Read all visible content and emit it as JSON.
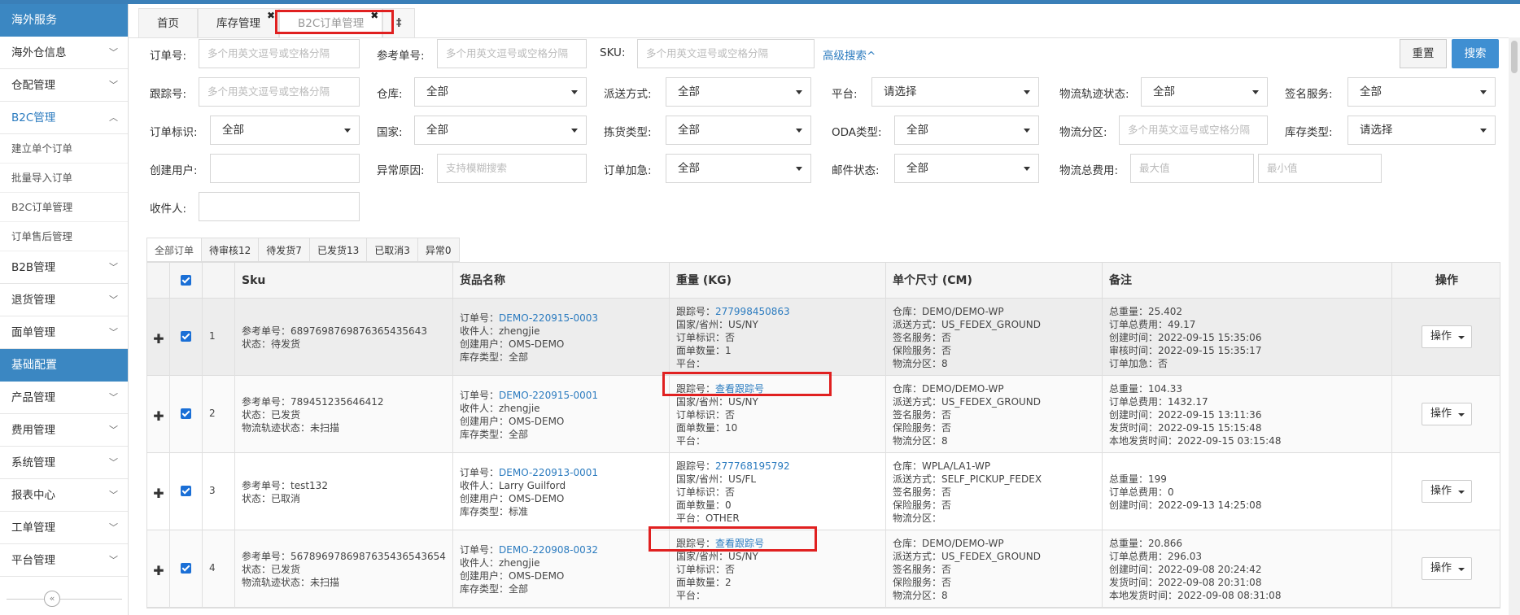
{
  "sidebar": {
    "section1": "海外服务",
    "items1": [
      {
        "label": "海外仓信息",
        "chev": "﹀"
      },
      {
        "label": "仓配管理",
        "chev": "﹀"
      },
      {
        "label": "B2C管理",
        "chev": "︿"
      }
    ],
    "sub": [
      "建立单个订单",
      "批量导入订单",
      "B2C订单管理",
      "订单售后管理"
    ],
    "items2": [
      {
        "label": "B2B管理",
        "chev": "﹀"
      },
      {
        "label": "退货管理",
        "chev": "﹀"
      },
      {
        "label": "面单管理",
        "chev": "﹀"
      }
    ],
    "section2": "基础配置",
    "items3": [
      {
        "label": "产品管理",
        "chev": "﹀"
      },
      {
        "label": "费用管理",
        "chev": "﹀"
      },
      {
        "label": "系统管理",
        "chev": "﹀"
      },
      {
        "label": "报表中心",
        "chev": "﹀"
      },
      {
        "label": "工单管理",
        "chev": "﹀"
      },
      {
        "label": "平台管理",
        "chev": "﹀"
      }
    ],
    "collapse": "«"
  },
  "tabs": [
    {
      "label": "首页"
    },
    {
      "label": "库存管理",
      "close": "✖"
    },
    {
      "label": "B2C订单管理",
      "close": "✖"
    }
  ],
  "tab_extra": "‡",
  "filters": {
    "order_no": {
      "label": "订单号:",
      "placeholder": "多个用英文逗号或空格分隔"
    },
    "ref_no": {
      "label": "参考单号:",
      "placeholder": "多个用英文逗号或空格分隔"
    },
    "sku": {
      "label": "SKU:",
      "placeholder": "多个用英文逗号或空格分隔"
    },
    "advanced": "高级搜索^",
    "tracking": {
      "label": "跟踪号:",
      "placeholder": "多个用英文逗号或空格分隔"
    },
    "warehouse": {
      "label": "仓库:",
      "value": "全部"
    },
    "delivery": {
      "label": "派送方式:",
      "value": "全部"
    },
    "platform": {
      "label": "平台:",
      "value": "请选择"
    },
    "track_status": {
      "label": "物流轨迹状态:",
      "value": "全部"
    },
    "signature": {
      "label": "签名服务:",
      "value": "全部"
    },
    "order_flag": {
      "label": "订单标识:",
      "value": "全部"
    },
    "country": {
      "label": "国家:",
      "value": "全部"
    },
    "pick_type": {
      "label": "拣货类型:",
      "value": "全部"
    },
    "oda_type": {
      "label": "ODA类型:",
      "value": "全部"
    },
    "zone": {
      "label": "物流分区:",
      "placeholder": "多个用英文逗号或空格分隔"
    },
    "stock_type": {
      "label": "库存类型:",
      "value": "请选择"
    },
    "creator": {
      "label": "创建用户:",
      "placeholder": ""
    },
    "exception": {
      "label": "异常原因:",
      "placeholder": "支持模糊搜索"
    },
    "urgent": {
      "label": "订单加急:",
      "value": "全部"
    },
    "mail_status": {
      "label": "邮件状态:",
      "value": "全部"
    },
    "total_fee": {
      "label": "物流总费用:",
      "max": "最大值",
      "min": "最小值"
    },
    "receiver": {
      "label": "收件人:",
      "placeholder": ""
    }
  },
  "buttons": {
    "reset": "重置",
    "search": "搜索"
  },
  "status_tabs": [
    "全部订单",
    "待审核12",
    "待发货7",
    "已发货13",
    "已取消3",
    "异常0"
  ],
  "table": {
    "headers": {
      "sku": "Sku",
      "goods": "货品名称",
      "weight": "重量 (KG)",
      "size": "单个尺寸 (CM)",
      "remark": "备注",
      "op": "操作"
    },
    "expand_icon": "✚",
    "op_label": "操作",
    "rows": [
      {
        "idx": "1",
        "sku": [
          "参考单号：6897698769876365435643",
          "状态：待发货"
        ],
        "order_label": "订单号：",
        "order_no": "DEMO-220915-0003",
        "goods": [
          "收件人：zhengjie",
          "创建用户：OMS-DEMO",
          "库存类型：全部"
        ],
        "track_label": "跟踪号：",
        "track_no": "277998450863",
        "weight": [
          "国家/省州：US/NY",
          "订单标识：否",
          "面单数量：1",
          "平台："
        ],
        "size": [
          "仓库：DEMO/DEMO-WP",
          "派送方式：US_FEDEX_GROUND",
          "签名服务：否",
          "保险服务：否",
          "物流分区：8"
        ],
        "remark": [
          "总重量：25.402",
          "订单总费用：49.17",
          "创建时间：2022-09-15 15:35:06",
          "审核时间：2022-09-15 15:35:17",
          "订单加急：否"
        ]
      },
      {
        "idx": "2",
        "sku": [
          "参考单号：789451235646412",
          "状态：已发货",
          "物流轨迹状态：未扫描"
        ],
        "order_label": "订单号：",
        "order_no": "DEMO-220915-0001",
        "goods": [
          "收件人：zhengjie",
          "创建用户：OMS-DEMO",
          "库存类型：全部"
        ],
        "track_label": "跟踪号：",
        "track_no": "查看跟踪号",
        "weight": [
          "国家/省州：US/NY",
          "订单标识：否",
          "面单数量：10",
          "平台："
        ],
        "size": [
          "仓库：DEMO/DEMO-WP",
          "派送方式：US_FEDEX_GROUND",
          "签名服务：否",
          "保险服务：否",
          "物流分区：8"
        ],
        "remark": [
          "总重量：104.33",
          "订单总费用：1432.17",
          "创建时间：2022-09-15 13:11:36",
          "发货时间：2022-09-15 15:15:48",
          "本地发货时间：2022-09-15 03:15:48"
        ]
      },
      {
        "idx": "3",
        "sku": [
          "参考单号：test132",
          "状态：已取消"
        ],
        "order_label": "订单号：",
        "order_no": "DEMO-220913-0001",
        "goods": [
          "收件人：Larry Guilford",
          "创建用户：OMS-DEMO",
          "库存类型：标准"
        ],
        "track_label": "跟踪号：",
        "track_no": "277768195792",
        "weight": [
          "国家/省州：US/FL",
          "订单标识：否",
          "面单数量：0",
          "平台：OTHER"
        ],
        "size": [
          "仓库：WPLA/LA1-WP",
          "派送方式：SELF_PICKUP_FEDEX",
          "签名服务：否",
          "保险服务：否",
          "物流分区："
        ],
        "remark": [
          "总重量：199",
          "订单总费用：0",
          "创建时间：2022-09-13 14:25:08"
        ]
      },
      {
        "idx": "4",
        "sku": [
          "参考单号：5678969786987635436543654",
          "状态：已发货",
          "物流轨迹状态：未扫描"
        ],
        "order_label": "订单号：",
        "order_no": "DEMO-220908-0032",
        "goods": [
          "收件人：zhengjie",
          "创建用户：OMS-DEMO",
          "库存类型：全部"
        ],
        "track_label": "跟踪号：",
        "track_no": "查看跟踪号",
        "weight": [
          "国家/省州：US/NY",
          "订单标识：否",
          "面单数量：2",
          "平台："
        ],
        "size": [
          "仓库：DEMO/DEMO-WP",
          "派送方式：US_FEDEX_GROUND",
          "签名服务：否",
          "保险服务：否",
          "物流分区：8"
        ],
        "remark": [
          "总重量：20.866",
          "订单总费用：296.03",
          "创建时间：2022-09-08 20:24:42",
          "发货时间：2022-09-08 20:31:08",
          "本地发货时间：2022-09-08 08:31:08"
        ]
      }
    ]
  }
}
